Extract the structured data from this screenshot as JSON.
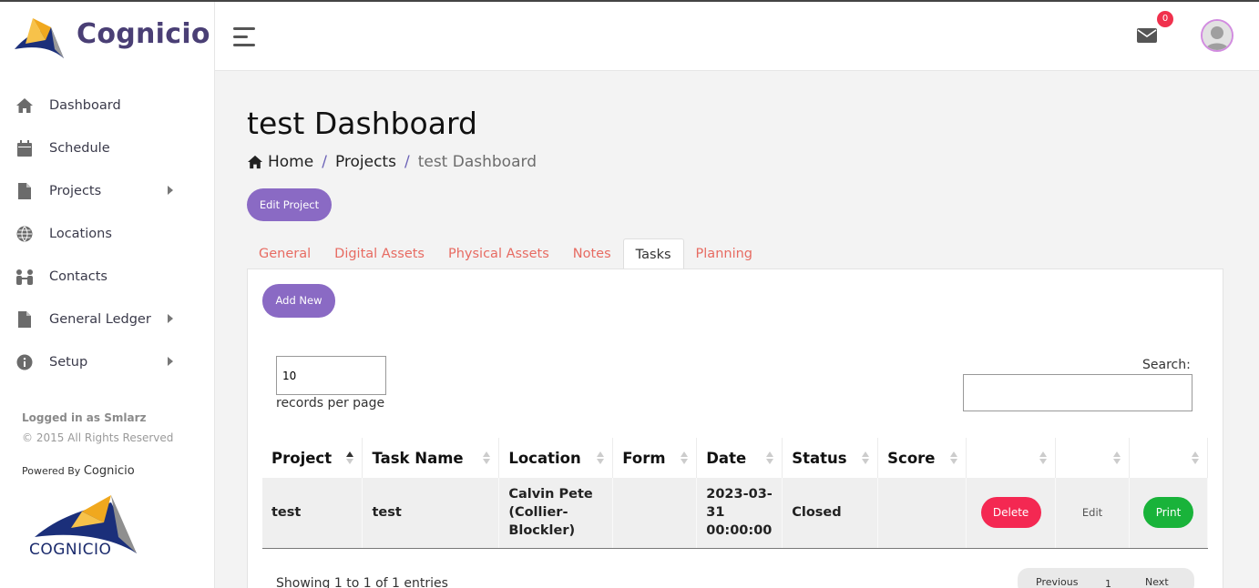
{
  "app": {
    "brand": "Cognicio"
  },
  "sidebar": {
    "items": [
      {
        "label": "Dashboard",
        "icon": "home-icon"
      },
      {
        "label": "Schedule",
        "icon": "calendar-icon"
      },
      {
        "label": "Projects",
        "icon": "file-icon",
        "submenu": true
      },
      {
        "label": "Locations",
        "icon": "globe-icon"
      },
      {
        "label": "Contacts",
        "icon": "users-icon"
      },
      {
        "label": "General Ledger",
        "icon": "file-icon",
        "submenu": true
      },
      {
        "label": "Setup",
        "icon": "info-icon",
        "submenu": true
      }
    ],
    "logged_in": "Logged in as Smlarz",
    "rights": "© 2015 All Rights Reserved",
    "powered_by": "Powered By",
    "powered_brand": "Cognicio",
    "logo_text": "COGNICIO"
  },
  "header": {
    "mail_count": "0"
  },
  "page": {
    "title": "test Dashboard",
    "breadcrumb": {
      "home": "Home",
      "projects": "Projects",
      "current": "test Dashboard",
      "separator": "/"
    },
    "edit_project": "Edit Project",
    "tabs": [
      {
        "label": "General",
        "active": false
      },
      {
        "label": "Digital Assets",
        "active": false
      },
      {
        "label": "Physical Assets",
        "active": false
      },
      {
        "label": "Notes",
        "active": false
      },
      {
        "label": "Tasks",
        "active": true
      },
      {
        "label": "Planning",
        "active": false
      }
    ],
    "add_new": "Add New",
    "per_page_value": "10",
    "per_page_label": "records per page",
    "search_label": "Search:",
    "search_value": ""
  },
  "table": {
    "headers": [
      "Project",
      "Task Name",
      "Location",
      "Form",
      "Date",
      "Status",
      "Score",
      "",
      "",
      ""
    ],
    "rows": [
      {
        "project": "test",
        "task_name": "test",
        "location_lines": [
          "Calvin Pete",
          "(Collier-",
          "Blockler)"
        ],
        "form": "",
        "date_lines": [
          "2023-03-",
          "31",
          "00:00:00"
        ],
        "status": "Closed",
        "score": "",
        "delete": "Delete",
        "edit": "Edit",
        "print": "Print"
      }
    ]
  },
  "footer": {
    "showing": "Showing 1 to 1 of 1 entries",
    "previous": "Previous",
    "page": "1",
    "next": "Next"
  },
  "colors": {
    "brand": "#4a3f75",
    "accent_purple": "#8a6ac4",
    "tab_link": "#e76b62",
    "delete": "#f42852",
    "print": "#19b33a",
    "badge": "#f0314d"
  }
}
